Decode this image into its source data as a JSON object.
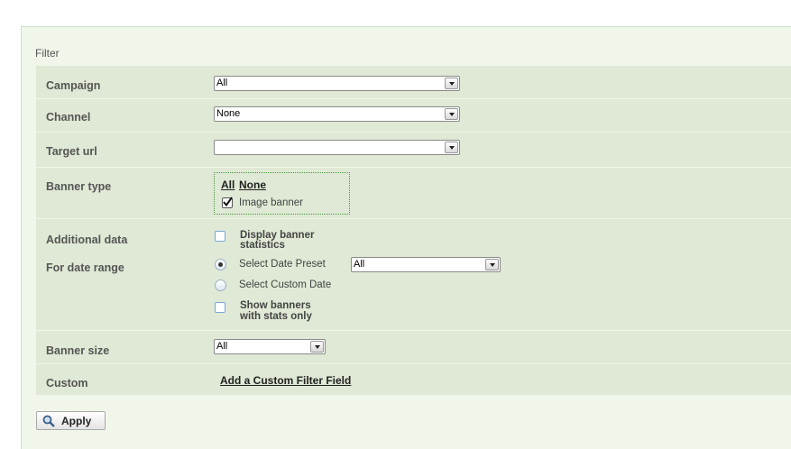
{
  "filter": {
    "title": "Filter",
    "campaign": {
      "label": "Campaign",
      "value": "All"
    },
    "channel": {
      "label": "Channel",
      "value": "None"
    },
    "target_url": {
      "label": "Target url",
      "value": ""
    },
    "banner_type": {
      "label": "Banner type",
      "all_link": "All",
      "none_link": "None",
      "image_banner": {
        "label": "Image banner",
        "checked": true
      }
    },
    "additional": {
      "label": "Additional data",
      "display_stats": "Display banner statistics",
      "display_stats_line1": "Display banner",
      "display_stats_line2": "statistics",
      "date_range_label": "For date range",
      "select_preset": "Select Date Preset",
      "preset_value": "All",
      "select_custom": "Select Custom Date",
      "show_banners_line1": "Show banners",
      "show_banners_line2": "with stats only"
    },
    "banner_size": {
      "label": "Banner size",
      "value": "All"
    },
    "custom": {
      "label": "Custom",
      "add_link": "Add a Custom Filter Field"
    },
    "apply_label": "Apply"
  }
}
